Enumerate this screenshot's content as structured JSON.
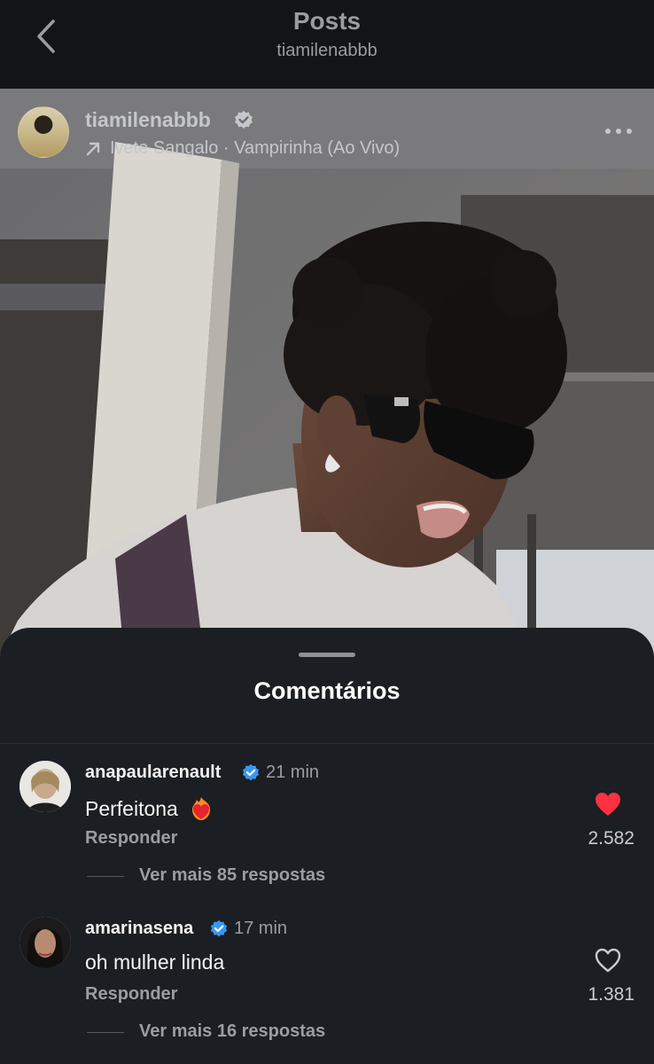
{
  "nav": {
    "title": "Posts",
    "subtitle": "tiamilenabbb"
  },
  "post": {
    "author": "tiamilenabbb",
    "audio": "Ivete Sangalo · Vampirinha (Ao Vivo)"
  },
  "comments_sheet": {
    "title": "Comentários",
    "comments": [
      {
        "username": "anapaularenault",
        "time": "21 min",
        "text": "Perfeitona",
        "reply_label": "Responder",
        "view_replies": "Ver mais 85 respostas",
        "likes": "2.582",
        "liked": true
      },
      {
        "username": "amarinasena",
        "time": "17 min",
        "text": "oh mulher linda",
        "reply_label": "Responder",
        "view_replies": "Ver mais 16 respostas",
        "likes": "1.381",
        "liked": false
      }
    ]
  },
  "colors": {
    "verified": "#3897f0",
    "like": "#ff3040",
    "sheet_bg": "#1b1e22"
  }
}
